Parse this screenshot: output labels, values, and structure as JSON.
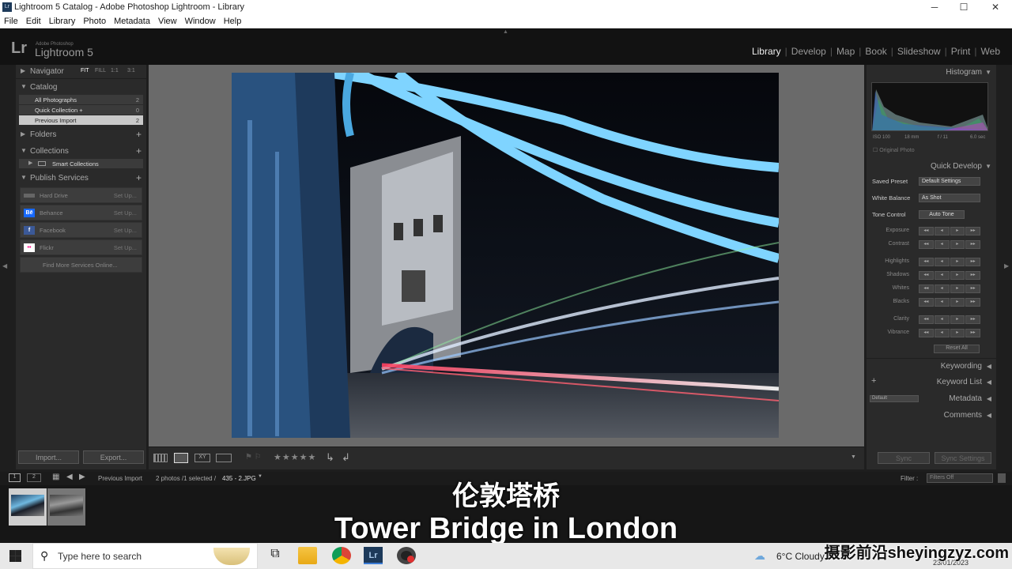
{
  "titlebar": {
    "title": "Lightroom 5 Catalog - Adobe Photoshop Lightroom - Library",
    "icon": "Lr",
    "minimize": "─",
    "maximize": "☐",
    "close": "✕"
  },
  "menu": [
    "File",
    "Edit",
    "Library",
    "Photo",
    "Metadata",
    "View",
    "Window",
    "Help"
  ],
  "identity": {
    "logo": "Lr",
    "adobe": "Adobe Photoshop",
    "product": "Lightroom 5"
  },
  "modules": [
    "Library",
    "Develop",
    "Map",
    "Book",
    "Slideshow",
    "Print",
    "Web"
  ],
  "active_module": "Library",
  "left": {
    "navigator": {
      "label": "Navigator",
      "fit": "FIT",
      "fill": "FILL",
      "r1": "1:1",
      "r2": "3:1"
    },
    "catalog": {
      "label": "Catalog",
      "items": [
        {
          "label": "All Photographs",
          "count": "2"
        },
        {
          "label": "Quick Collection +",
          "count": "0"
        },
        {
          "label": "Previous Import",
          "count": "2"
        }
      ]
    },
    "folders": {
      "label": "Folders"
    },
    "collections": {
      "label": "Collections",
      "smart": "Smart Collections"
    },
    "publish": {
      "label": "Publish Services",
      "items": [
        {
          "label": "Hard Drive",
          "setup": "Set Up..."
        },
        {
          "label": "Behance",
          "setup": "Set Up...",
          "icon": "Bē"
        },
        {
          "label": "Facebook",
          "setup": "Set Up...",
          "icon": "f"
        },
        {
          "label": "Flickr",
          "setup": "Set Up...",
          "icon": "••"
        }
      ],
      "more": "Find More Services Online..."
    },
    "import_btn": "Import...",
    "export_btn": "Export..."
  },
  "right": {
    "histogram": {
      "label": "Histogram",
      "iso": "ISO 100",
      "focal": "18 mm",
      "aperture": "f / 11",
      "shutter": "6.0 sec",
      "original": "Original Photo"
    },
    "quick_develop": {
      "label": "Quick Develop",
      "saved_preset": "Saved Preset",
      "saved_preset_val": "Default Settings",
      "white_balance": "White Balance",
      "white_balance_val": "As Shot",
      "tone_control": "Tone Control",
      "auto_tone": "Auto Tone",
      "sliders": [
        "Exposure",
        "Contrast",
        "Highlights",
        "Shadows",
        "Whites",
        "Blacks",
        "Clarity",
        "Vibrance"
      ],
      "reset": "Reset All"
    },
    "keywording": "Keywording",
    "keyword_list": "Keyword List",
    "metadata": "Metadata",
    "metadata_preset": "Default",
    "comments": "Comments",
    "sync": "Sync",
    "sync_settings": "Sync Settings"
  },
  "toolbar": {
    "stars": "★★★★★"
  },
  "filmstrip": {
    "source": "Previous Import",
    "info": "2 photos /1 selected /",
    "file": "435 - 2.JPG",
    "filter_label": "Filter :",
    "filter_val": "Filters Off",
    "b1": "1",
    "b2": "2"
  },
  "subtitles": {
    "zh": "伦敦塔桥",
    "en": "Tower Bridge in London"
  },
  "taskbar": {
    "search_placeholder": "Type here to search",
    "weather": "6°C  Cloudy",
    "date": "23/01/2023"
  },
  "watermark": "摄影前沿sheyingzyz.com"
}
